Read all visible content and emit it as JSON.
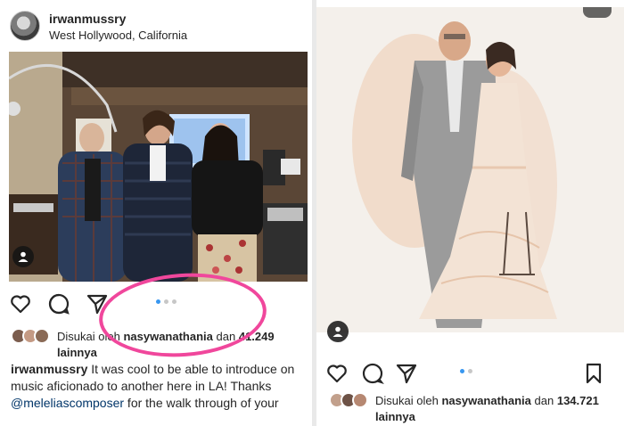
{
  "left_post": {
    "username": "irwanmussry",
    "location": "West Hollywood, California",
    "carousel": {
      "current": 1,
      "total": 3
    },
    "likes": {
      "prefix": "Disukai oleh",
      "user": "nasywanathania",
      "mid": "dan",
      "count": "41.249",
      "suffix": "lainnya"
    },
    "caption": {
      "user": "irwanmussry",
      "line1": " It was cool to be able to introduce on",
      "line2": "music aficionado to another here in LA! Thanks",
      "mention": "@meleliascomposer",
      "line3": " for the walk through of your"
    }
  },
  "right_post": {
    "carousel": {
      "current": 1,
      "total": 2
    },
    "likes": {
      "prefix": "Disukai oleh",
      "user": "nasywanathania",
      "mid": "dan",
      "count": "134.721",
      "suffix": "lainnya"
    }
  },
  "colors": {
    "highlight": "#f0479c",
    "active_dot": "#3897f0",
    "inactive_dot": "#c7c7c7",
    "mention": "#003569"
  },
  "icons": [
    "heart-icon",
    "comment-icon",
    "share-icon",
    "bookmark-icon",
    "user-tag-icon"
  ]
}
